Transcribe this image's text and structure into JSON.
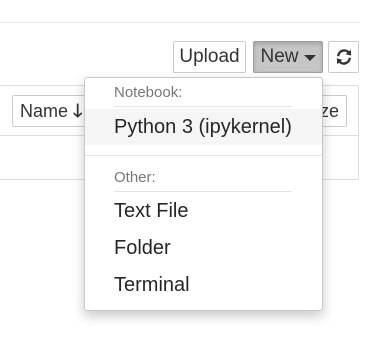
{
  "toolbar": {
    "upload_label": "Upload",
    "new_label": "New",
    "new_caret_icon": "caret-down-icon",
    "refresh_icon": "refresh-icon"
  },
  "file_list": {
    "sort_name_label": "Name",
    "sort_name_icon": "arrow-down-icon",
    "sort_size_label": "ze"
  },
  "new_menu": {
    "notebook_header": "Notebook:",
    "notebook_items": [
      {
        "label": "Python 3 (ipykernel)",
        "active": true
      }
    ],
    "other_header": "Other:",
    "other_items": [
      {
        "label": "Text File"
      },
      {
        "label": "Folder"
      },
      {
        "label": "Terminal"
      }
    ]
  },
  "colors": {
    "new_button_active_bg": "#c6c6c6",
    "menu_item_hover_bg": "#f5f5f5",
    "header_text": "#777777"
  }
}
